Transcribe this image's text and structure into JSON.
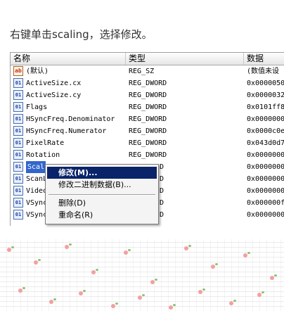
{
  "caption": "右键单击scaling，选择修改。",
  "columns": {
    "name": "名称",
    "type": "类型",
    "data": "数据"
  },
  "rows": [
    {
      "icon": "ab",
      "name": "(默认)",
      "type": "REG_SZ",
      "data": "(数值未设"
    },
    {
      "icon": "bin",
      "name": "ActiveSize.cx",
      "type": "REG_DWORD",
      "data": "0x0000050"
    },
    {
      "icon": "bin",
      "name": "ActiveSize.cy",
      "type": "REG_DWORD",
      "data": "0x0000032"
    },
    {
      "icon": "bin",
      "name": "Flags",
      "type": "REG_DWORD",
      "data": "0x0101ff8"
    },
    {
      "icon": "bin",
      "name": "HSyncFreq.Denominator",
      "type": "REG_DWORD",
      "data": "0x0000000"
    },
    {
      "icon": "bin",
      "name": "HSyncFreq.Numerator",
      "type": "REG_DWORD",
      "data": "0x0000c0e"
    },
    {
      "icon": "bin",
      "name": "PixelRate",
      "type": "REG_DWORD",
      "data": "0x043d0d7"
    },
    {
      "icon": "bin",
      "name": "Rotation",
      "type": "REG_DWORD",
      "data": "0x0000000"
    },
    {
      "icon": "bin",
      "name": "Scal",
      "type": "D",
      "data": "0x0000000"
    },
    {
      "icon": "bin",
      "name": "ScanL",
      "type": "D",
      "data": "0x0000000"
    },
    {
      "icon": "bin",
      "name": "Video",
      "type": "D",
      "data": "0x0000000"
    },
    {
      "icon": "bin",
      "name": "VSync",
      "type": "D",
      "data": "0x000000f"
    },
    {
      "icon": "bin",
      "name": "VSync",
      "type": "D",
      "data": "0x0000000"
    }
  ],
  "context_menu": {
    "modify": "修改(M)...",
    "modify_binary": "修改二进制数据(B)...",
    "delete": "删除(D)",
    "rename": "重命名(R)"
  }
}
